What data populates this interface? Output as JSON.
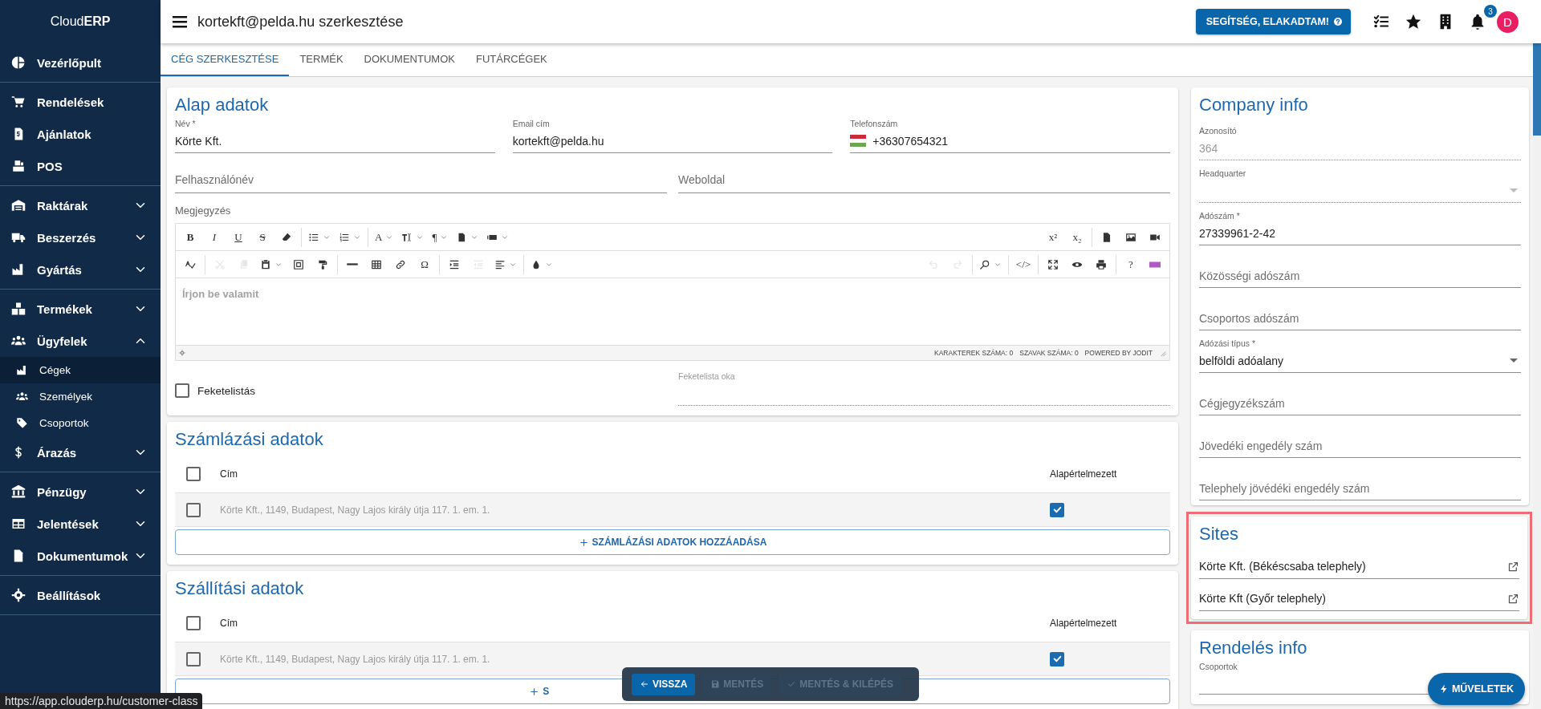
{
  "brand": "Cloud**ERP**",
  "topbar": {
    "title": "kortekft@pelda.hu szerkesztése",
    "help_button": "SEGÍTSÉG, ELAKADTAM!",
    "notifications": "3",
    "avatar": "D"
  },
  "sidebar": {
    "groups": [
      [
        {
          "label": "Vezérlőpult",
          "kind": "link"
        }
      ],
      [
        {
          "label": "Rendelések",
          "kind": "link"
        },
        {
          "label": "Ajánlatok",
          "kind": "link"
        },
        {
          "label": "POS",
          "kind": "link"
        }
      ],
      [
        {
          "label": "Raktárak",
          "kind": "group",
          "expanded": false
        },
        {
          "label": "Beszerzés",
          "kind": "group",
          "expanded": false
        },
        {
          "label": "Gyártás",
          "kind": "group",
          "expanded": false
        }
      ],
      [
        {
          "label": "Termékek",
          "kind": "group",
          "expanded": false
        },
        {
          "label": "Ügyfelek",
          "kind": "group",
          "expanded": true,
          "children": [
            {
              "label": "Cégek",
              "selected": true
            },
            {
              "label": "Személyek",
              "selected": false
            },
            {
              "label": "Csoportok",
              "selected": false
            }
          ]
        },
        {
          "label": "Árazás",
          "kind": "group",
          "expanded": false
        }
      ],
      [
        {
          "label": "Pénzügy",
          "kind": "group",
          "expanded": false
        },
        {
          "label": "Jelentések",
          "kind": "group",
          "expanded": false
        },
        {
          "label": "Dokumentumok",
          "kind": "group",
          "expanded": false
        }
      ],
      [
        {
          "label": "Beállítások",
          "kind": "link"
        }
      ]
    ]
  },
  "tabs": [
    {
      "label": "CÉG SZERKESZTÉSE",
      "selected": true
    },
    {
      "label": "TERMÉK",
      "selected": false
    },
    {
      "label": "DOKUMENTUMOK",
      "selected": false
    },
    {
      "label": "FUTÁRCÉGEK",
      "selected": false
    }
  ],
  "basic": {
    "title": "Alap adatok",
    "name": {
      "label": "Név *",
      "value": "Körte Kft."
    },
    "email": {
      "label": "Email cím",
      "value": "kortekft@pelda.hu"
    },
    "phone": {
      "label": "Telefonszám",
      "value": "+36307654321"
    },
    "username": {
      "placeholder": "Felhasználónév"
    },
    "website": {
      "placeholder": "Weboldal"
    },
    "note_label": "Megjegyzés",
    "editor": {
      "placeholder": "Írjon be valamit",
      "status": [
        "KARAKTEREK SZÁMA: 0",
        "SZAVAK SZÁMA: 0",
        "POWERED BY JODIT"
      ],
      "rows": [
        {
          "left": [
            [
              {
                "kind": "bold",
                "label": "B",
                "menu": false,
                "disabled": false
              },
              {
                "kind": "italic",
                "label": "I",
                "menu": false,
                "disabled": false
              },
              {
                "kind": "underline",
                "label": "U",
                "menu": false,
                "disabled": false
              },
              {
                "kind": "strike",
                "label": "S",
                "menu": false,
                "disabled": false
              },
              {
                "kind": "icon",
                "menu": false,
                "disabled": false
              }
            ],
            [
              {
                "kind": "icon",
                "menu": true,
                "disabled": false
              },
              {
                "kind": "icon",
                "menu": true,
                "disabled": false
              }
            ],
            [
              {
                "kind": "glyph",
                "label": "A",
                "menu": true,
                "disabled": false
              },
              {
                "kind": "icon",
                "menu": true,
                "disabled": false
              },
              {
                "kind": "glyph",
                "label": "¶",
                "menu": true,
                "disabled": false
              },
              {
                "kind": "icon",
                "menu": true,
                "disabled": false
              },
              {
                "kind": "icon",
                "menu": true,
                "disabled": false
              }
            ]
          ],
          "right": [
            [
              {
                "kind": "glyph",
                "label": "x²",
                "menu": false,
                "disabled": false
              },
              {
                "kind": "glyph",
                "label": "x₂",
                "menu": false,
                "disabled": false
              }
            ],
            [
              {
                "kind": "icon",
                "menu": false,
                "disabled": false
              },
              {
                "kind": "icon",
                "menu": false,
                "disabled": false
              },
              {
                "kind": "icon",
                "menu": false,
                "disabled": false
              }
            ]
          ]
        },
        {
          "left": [
            [
              {
                "kind": "icon",
                "menu": false,
                "disabled": false
              }
            ],
            [
              {
                "kind": "icon",
                "menu": false,
                "disabled": true
              },
              {
                "kind": "icon",
                "menu": false,
                "disabled": true
              },
              {
                "kind": "icon",
                "menu": true,
                "disabled": false
              },
              {
                "kind": "icon",
                "menu": false,
                "disabled": false
              },
              {
                "kind": "icon",
                "menu": false,
                "disabled": false
              }
            ],
            [
              {
                "kind": "icon",
                "menu": false,
                "disabled": false
              },
              {
                "kind": "icon",
                "menu": false,
                "disabled": false
              },
              {
                "kind": "icon",
                "menu": false,
                "disabled": false
              },
              {
                "kind": "glyph",
                "label": "Ω",
                "menu": false,
                "disabled": false
              }
            ],
            [
              {
                "kind": "icon",
                "menu": false,
                "disabled": false
              },
              {
                "kind": "icon",
                "menu": false,
                "disabled": true
              },
              {
                "kind": "icon",
                "menu": true,
                "disabled": false
              }
            ],
            [
              {
                "kind": "icon",
                "menu": true,
                "disabled": false
              }
            ]
          ],
          "right": [
            [
              {
                "kind": "icon",
                "menu": false,
                "disabled": true
              },
              {
                "kind": "icon",
                "menu": false,
                "disabled": true
              }
            ],
            [
              {
                "kind": "icon",
                "menu": true,
                "disabled": false
              }
            ],
            [
              {
                "kind": "glyph",
                "label": "</>",
                "menu": false,
                "disabled": false
              }
            ],
            [
              {
                "kind": "icon",
                "menu": false,
                "disabled": false
              },
              {
                "kind": "icon",
                "menu": false,
                "disabled": false
              },
              {
                "kind": "icon",
                "menu": false,
                "disabled": false
              }
            ],
            [
              {
                "kind": "glyph",
                "label": "?",
                "menu": false,
                "disabled": false
              },
              {
                "kind": "icon",
                "menu": false,
                "disabled": false
              }
            ]
          ]
        }
      ]
    },
    "blacklist": {
      "label": "Feketelistás",
      "checked": false
    },
    "blacklist_reason": {
      "label": "Feketelista oka",
      "disabled": true
    }
  },
  "billing": {
    "title": "Számlázási adatok",
    "columns": [
      "Cím",
      "Alapértelmezett"
    ],
    "header_checked": false,
    "rows": [
      {
        "address": "Körte Kft., 1149, Budapest, Nagy Lajos király útja 117. 1. em. 1.",
        "checked": false,
        "default": true
      }
    ],
    "add_button": "SZÁMLÁZÁSI ADATOK HOZZÁADÁSA"
  },
  "shipping": {
    "title": "Szállítási adatok",
    "columns": [
      "Cím",
      "Alapértelmezett"
    ],
    "header_checked": false,
    "rows": [
      {
        "address": "Körte Kft., 1149, Budapest, Nagy Lajos király útja 117. 1. em. 1.",
        "checked": false,
        "default": true
      }
    ],
    "add_button": "S"
  },
  "company": {
    "title": "Company info",
    "fields": [
      {
        "kind": "text",
        "label": "Azonosító",
        "value": "364",
        "disabled": true
      },
      {
        "kind": "select",
        "label": "Headquarter",
        "disabled": true
      },
      {
        "kind": "text",
        "label": "Adószám *",
        "value": "27339961-2-42",
        "disabled": false
      },
      {
        "kind": "text",
        "placeholder": "Közösségi adószám",
        "disabled": false
      },
      {
        "kind": "text",
        "placeholder": "Csoportos adószám",
        "disabled": false
      },
      {
        "kind": "select",
        "label": "Adózási típus *",
        "value": "belföldi adóalany",
        "disabled": false
      },
      {
        "kind": "text",
        "placeholder": "Cégjegyzékszám",
        "disabled": false
      },
      {
        "kind": "text",
        "placeholder": "Jövedéki engedély szám",
        "disabled": false
      },
      {
        "kind": "text",
        "placeholder": "Telephely jövédéki engedély szám",
        "disabled": false
      }
    ]
  },
  "sites": {
    "title": "Sites",
    "highlighted": true,
    "items": [
      "Körte Kft. (Békéscsaba telephely)",
      "Körte Kft (Győr telephely)"
    ]
  },
  "order_info": {
    "title": "Rendelés info",
    "fields": [
      {
        "label": "Csoportok"
      }
    ]
  },
  "actions": {
    "back": "VISSZA",
    "save": {
      "label": "MENTÉS",
      "disabled": true
    },
    "save_exit": {
      "label": "MENTÉS & KILÉPÉS",
      "disabled": true
    }
  },
  "fab": "MŰVELETEK",
  "status_url": "https://app.clouderp.hu/customer-class"
}
